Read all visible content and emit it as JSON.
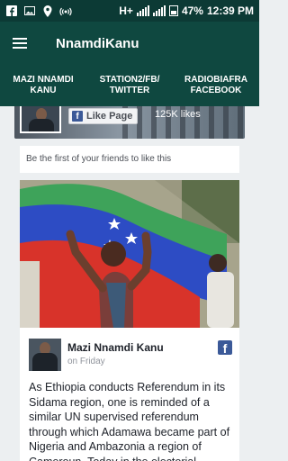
{
  "status_bar": {
    "network": "H+",
    "battery": "47%",
    "time": "12:39 PM",
    "icons": [
      "facebook-icon",
      "image-icon",
      "location-icon",
      "hotspot-icon"
    ]
  },
  "app_bar": {
    "title": "NnamdiKanu",
    "menu_icon": "hamburger-menu-icon"
  },
  "tabs": [
    {
      "line1": "MAZI NNAMDI",
      "line2": "KANU"
    },
    {
      "line1": "STATION2/FB/",
      "line2": "TWITTER"
    },
    {
      "line1": "RADIOBIAFRA",
      "line2": "FACEBOOK"
    }
  ],
  "page_plugin": {
    "like_label": "Like Page",
    "likes": "125K likes",
    "friends_text": "Be the first of your friends to like this"
  },
  "post": {
    "author": "Mazi Nnamdi Kanu",
    "time": "on Friday",
    "text": "As Ethiopia conducts Referendum in its Sidama region, one is reminded of a similar UN supervised referendum through which Adamawa became part of Nigeria and Ambazonia a region of Cameroun. Today in the electorial"
  },
  "colors": {
    "status_bar": "#0c3a35",
    "app_bar": "#0f4840",
    "facebook_blue": "#3b5998"
  }
}
